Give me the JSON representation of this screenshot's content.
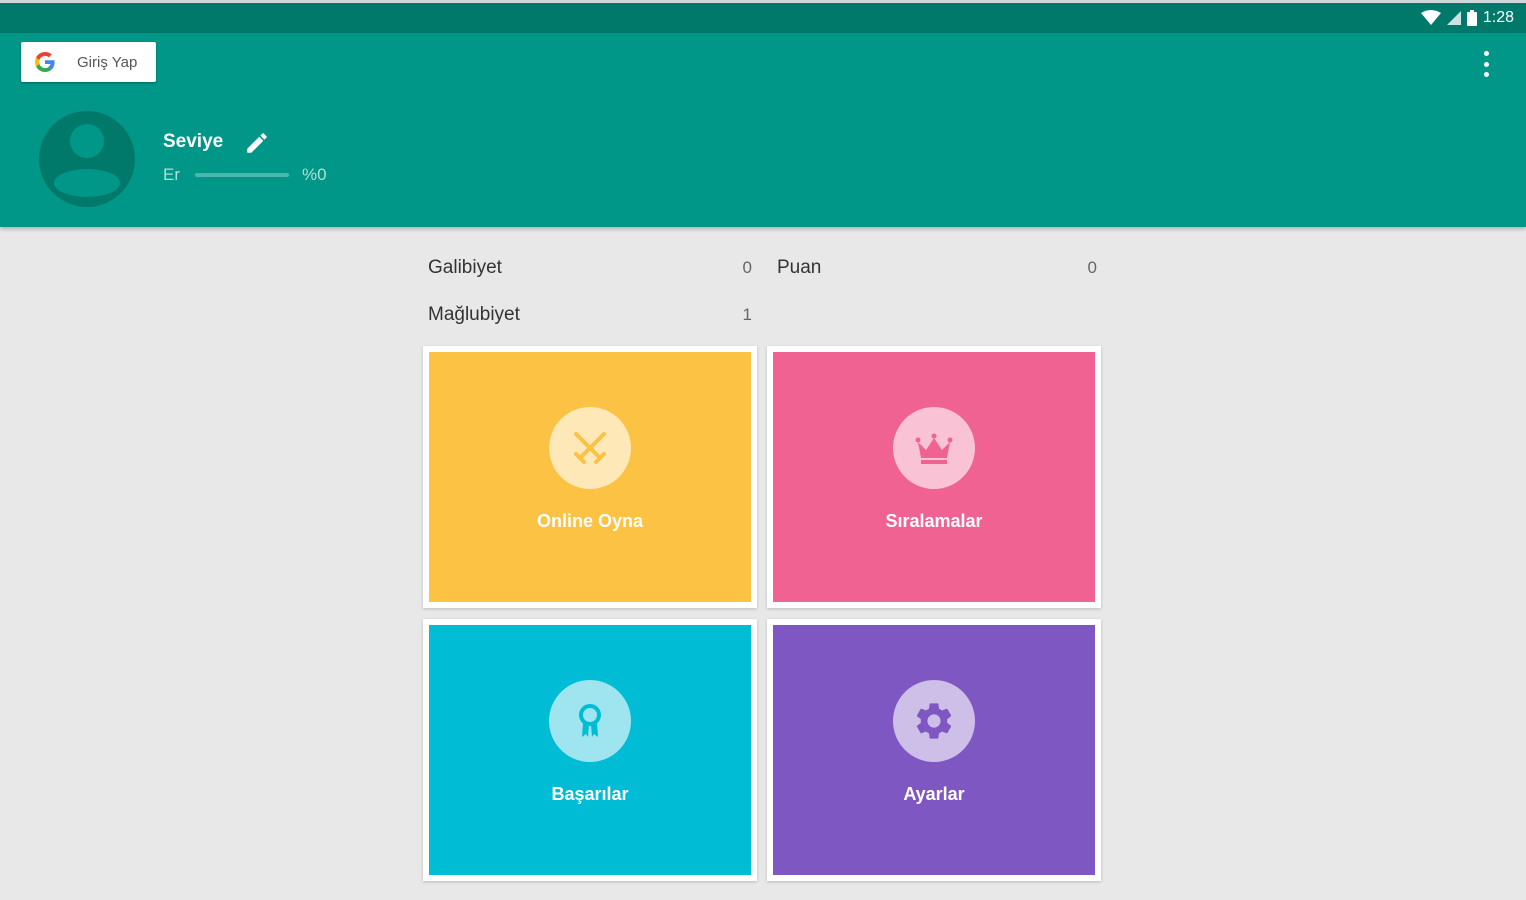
{
  "status_bar": {
    "time": "1:28"
  },
  "header": {
    "signin_label": "Giriş Yap",
    "level_title": "Seviye",
    "rank": "Er",
    "progress_percent": 0,
    "progress_label": "%0"
  },
  "stats": {
    "wins_label": "Galibiyet",
    "wins_value": "0",
    "points_label": "Puan",
    "points_value": "0",
    "losses_label": "Mağlubiyet",
    "losses_value": "1"
  },
  "tiles": [
    {
      "label": "Online Oyna",
      "color": "#fbc243",
      "icon": "swords-icon"
    },
    {
      "label": "Sıralamalar",
      "color": "#f06292",
      "icon": "crown-icon"
    },
    {
      "label": "Başarılar",
      "color": "#00bcd4",
      "icon": "award-icon"
    },
    {
      "label": "Ayarlar",
      "color": "#7e57c2",
      "icon": "gear-icon"
    }
  ],
  "colors": {
    "primary": "#009688",
    "primary_dark": "#00796b",
    "background": "#e8e8e8"
  }
}
